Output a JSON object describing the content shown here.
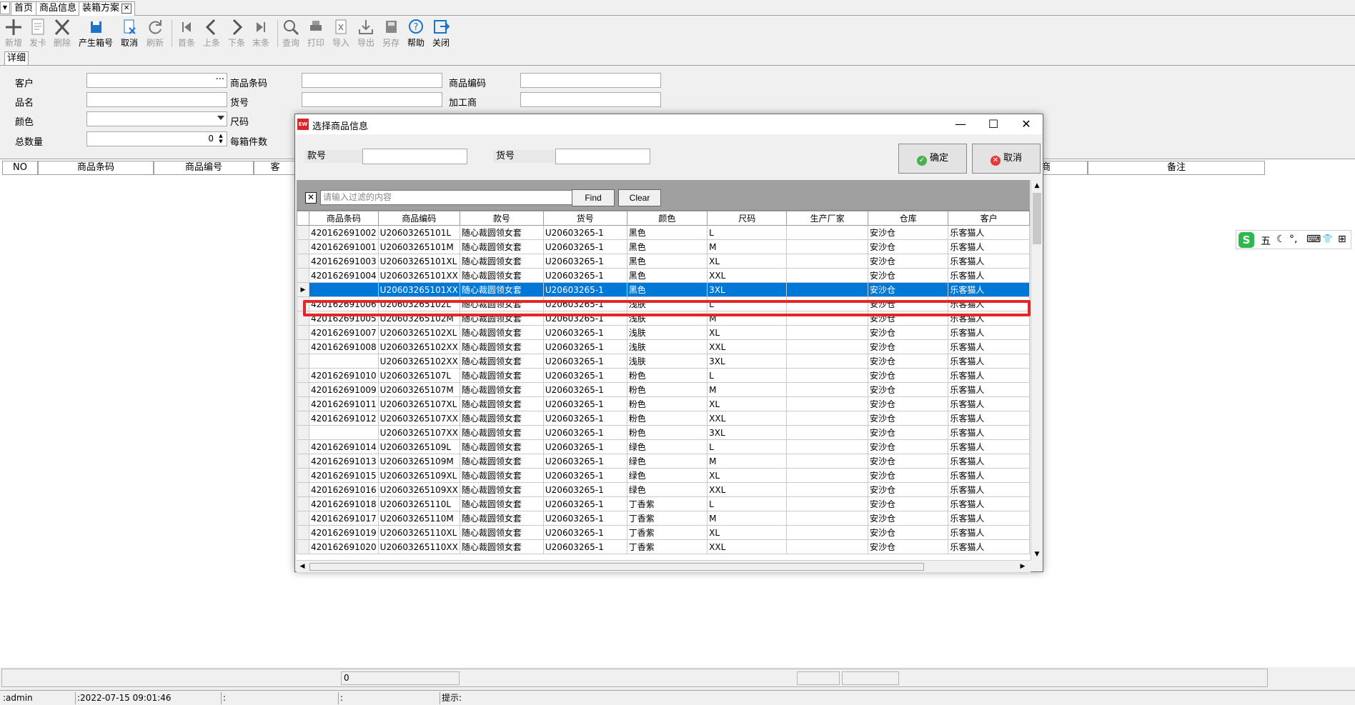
{
  "tabs": [
    {
      "label": "首页"
    },
    {
      "label": "商品信息"
    },
    {
      "label": "装箱方案"
    }
  ],
  "toolbar": {
    "new": "新增",
    "issue_card": "发卡",
    "delete": "删除",
    "generate_box_no": "产生箱号",
    "cancel": "取消",
    "refresh": "刷新",
    "first": "首条",
    "prev": "上条",
    "next": "下条",
    "last": "末条",
    "query": "查询",
    "print": "打印",
    "import": "导入",
    "export": "导出",
    "save_as": "另存",
    "help": "帮助",
    "close": "关闭"
  },
  "detail_tab": "详细",
  "form": {
    "customer_label": "客户",
    "barcode_label": "商品条码",
    "product_code_label": "商品编码",
    "name_label": "品名",
    "sku_label": "货号",
    "processor_label": "加工商",
    "color_label": "颜色",
    "size_label": "尺码",
    "total_qty_label": "总数量",
    "total_qty_value": "0",
    "per_box_label": "每箱件数"
  },
  "main_grid": {
    "headers": [
      "NO",
      "商品条码",
      "商品编号",
      "客",
      "商",
      "备注"
    ]
  },
  "pager": {
    "value": "0"
  },
  "status": {
    "user": ":admin",
    "datetime": ":2022-07-15 09:01:46",
    "field3": ":",
    "field4": ":",
    "hint": "提示:"
  },
  "ime": {
    "logo": "S",
    "mode": "五",
    "moon": "☾",
    "punct": "°,",
    "keyboard": "⌨",
    "skin": "👕",
    "grid": "⊞"
  },
  "dialog": {
    "app_icon": "EW",
    "title": "选择商品信息",
    "minimize": "—",
    "maximize": "☐",
    "close": "✕",
    "style_label": "款号",
    "sku_label": "货号",
    "ok_label": "确定",
    "cancel_label": "取消",
    "filter_placeholder": "请输入过滤的内容",
    "find_label": "Find",
    "clear_label": "Clear",
    "columns": [
      "商品条码",
      "商品编码",
      "款号",
      "货号",
      "颜色",
      "尺码",
      "生产厂家",
      "仓库",
      "客户"
    ],
    "rows": [
      {
        "barcode": "420162691002",
        "code": "U20603265101L",
        "style": "随心裁圆领女套",
        "sku": "U20603265-1",
        "color": "黑色",
        "size": "L",
        "maker": "",
        "warehouse": "安沙仓",
        "customer": "乐客猫人"
      },
      {
        "barcode": "420162691001",
        "code": "U20603265101M",
        "style": "随心裁圆领女套",
        "sku": "U20603265-1",
        "color": "黑色",
        "size": "M",
        "maker": "",
        "warehouse": "安沙仓",
        "customer": "乐客猫人"
      },
      {
        "barcode": "420162691003",
        "code": "U20603265101XL",
        "style": "随心裁圆领女套",
        "sku": "U20603265-1",
        "color": "黑色",
        "size": "XL",
        "maker": "",
        "warehouse": "安沙仓",
        "customer": "乐客猫人"
      },
      {
        "barcode": "420162691004",
        "code": "U20603265101XX",
        "style": "随心裁圆领女套",
        "sku": "U20603265-1",
        "color": "黑色",
        "size": "XXL",
        "maker": "",
        "warehouse": "安沙仓",
        "customer": "乐客猫人"
      },
      {
        "barcode": "",
        "code": "U20603265101XX",
        "style": "随心裁圆领女套",
        "sku": "U20603265-1",
        "color": "黑色",
        "size": "3XL",
        "maker": "",
        "warehouse": "安沙仓",
        "customer": "乐客猫人"
      },
      {
        "barcode": "420162691006",
        "code": "U20603265102L",
        "style": "随心裁圆领女套",
        "sku": "U20603265-1",
        "color": "浅肤",
        "size": "L",
        "maker": "",
        "warehouse": "安沙仓",
        "customer": "乐客猫人"
      },
      {
        "barcode": "420162691005",
        "code": "U20603265102M",
        "style": "随心裁圆领女套",
        "sku": "U20603265-1",
        "color": "浅肤",
        "size": "M",
        "maker": "",
        "warehouse": "安沙仓",
        "customer": "乐客猫人"
      },
      {
        "barcode": "420162691007",
        "code": "U20603265102XL",
        "style": "随心裁圆领女套",
        "sku": "U20603265-1",
        "color": "浅肤",
        "size": "XL",
        "maker": "",
        "warehouse": "安沙仓",
        "customer": "乐客猫人"
      },
      {
        "barcode": "420162691008",
        "code": "U20603265102XX",
        "style": "随心裁圆领女套",
        "sku": "U20603265-1",
        "color": "浅肤",
        "size": "XXL",
        "maker": "",
        "warehouse": "安沙仓",
        "customer": "乐客猫人"
      },
      {
        "barcode": "",
        "code": "U20603265102XX",
        "style": "随心裁圆领女套",
        "sku": "U20603265-1",
        "color": "浅肤",
        "size": "3XL",
        "maker": "",
        "warehouse": "安沙仓",
        "customer": "乐客猫人"
      },
      {
        "barcode": "420162691010",
        "code": "U20603265107L",
        "style": "随心裁圆领女套",
        "sku": "U20603265-1",
        "color": "粉色",
        "size": "L",
        "maker": "",
        "warehouse": "安沙仓",
        "customer": "乐客猫人"
      },
      {
        "barcode": "420162691009",
        "code": "U20603265107M",
        "style": "随心裁圆领女套",
        "sku": "U20603265-1",
        "color": "粉色",
        "size": "M",
        "maker": "",
        "warehouse": "安沙仓",
        "customer": "乐客猫人"
      },
      {
        "barcode": "420162691011",
        "code": "U20603265107XL",
        "style": "随心裁圆领女套",
        "sku": "U20603265-1",
        "color": "粉色",
        "size": "XL",
        "maker": "",
        "warehouse": "安沙仓",
        "customer": "乐客猫人"
      },
      {
        "barcode": "420162691012",
        "code": "U20603265107XX",
        "style": "随心裁圆领女套",
        "sku": "U20603265-1",
        "color": "粉色",
        "size": "XXL",
        "maker": "",
        "warehouse": "安沙仓",
        "customer": "乐客猫人"
      },
      {
        "barcode": "",
        "code": "U20603265107XX",
        "style": "随心裁圆领女套",
        "sku": "U20603265-1",
        "color": "粉色",
        "size": "3XL",
        "maker": "",
        "warehouse": "安沙仓",
        "customer": "乐客猫人"
      },
      {
        "barcode": "420162691014",
        "code": "U20603265109L",
        "style": "随心裁圆领女套",
        "sku": "U20603265-1",
        "color": "绿色",
        "size": "L",
        "maker": "",
        "warehouse": "安沙仓",
        "customer": "乐客猫人"
      },
      {
        "barcode": "420162691013",
        "code": "U20603265109M",
        "style": "随心裁圆领女套",
        "sku": "U20603265-1",
        "color": "绿色",
        "size": "M",
        "maker": "",
        "warehouse": "安沙仓",
        "customer": "乐客猫人"
      },
      {
        "barcode": "420162691015",
        "code": "U20603265109XL",
        "style": "随心裁圆领女套",
        "sku": "U20603265-1",
        "color": "绿色",
        "size": "XL",
        "maker": "",
        "warehouse": "安沙仓",
        "customer": "乐客猫人"
      },
      {
        "barcode": "420162691016",
        "code": "U20603265109XX",
        "style": "随心裁圆领女套",
        "sku": "U20603265-1",
        "color": "绿色",
        "size": "XXL",
        "maker": "",
        "warehouse": "安沙仓",
        "customer": "乐客猫人"
      },
      {
        "barcode": "420162691018",
        "code": "U20603265110L",
        "style": "随心裁圆领女套",
        "sku": "U20603265-1",
        "color": "丁香紫",
        "size": "L",
        "maker": "",
        "warehouse": "安沙仓",
        "customer": "乐客猫人"
      },
      {
        "barcode": "420162691017",
        "code": "U20603265110M",
        "style": "随心裁圆领女套",
        "sku": "U20603265-1",
        "color": "丁香紫",
        "size": "M",
        "maker": "",
        "warehouse": "安沙仓",
        "customer": "乐客猫人"
      },
      {
        "barcode": "420162691019",
        "code": "U20603265110XL",
        "style": "随心裁圆领女套",
        "sku": "U20603265-1",
        "color": "丁香紫",
        "size": "XL",
        "maker": "",
        "warehouse": "安沙仓",
        "customer": "乐客猫人"
      },
      {
        "barcode": "420162691020",
        "code": "U20603265110XX",
        "style": "随心裁圆领女套",
        "sku": "U20603265-1",
        "color": "丁香紫",
        "size": "XXL",
        "maker": "",
        "warehouse": "安沙仓",
        "customer": "乐客猫人"
      }
    ],
    "selected_row_index": 4,
    "highlighted_row_index": 5
  },
  "colors": {
    "selection": "#0078d7",
    "highlight_box": "#e3262a",
    "toolbar_accent": "#1a74c9"
  }
}
